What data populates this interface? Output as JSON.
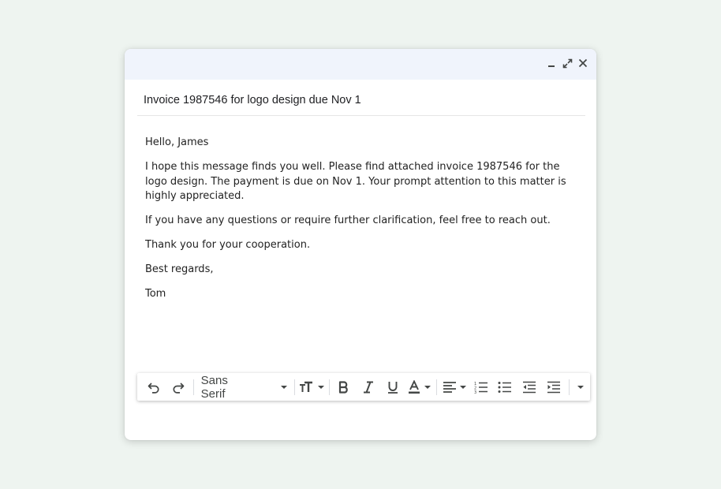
{
  "window": {
    "controls": [
      {
        "name": "minimize-icon"
      },
      {
        "name": "expand-icon"
      },
      {
        "name": "close-icon"
      }
    ]
  },
  "subject": "Invoice 1987546 for logo design due Nov 1",
  "body": {
    "greeting": "Hello, James",
    "paragraph1": "I hope this message finds you well. Please find attached invoice 1987546 for the logo design. The payment is due on Nov 1. Your prompt attention to this matter is highly appreciated.",
    "paragraph2": "If you have any questions or require further clarification, feel free to reach out.",
    "paragraph3": "Thank you for your cooperation.",
    "closing": "Best regards,",
    "signature": "Tom"
  },
  "toolbar": {
    "font_family": "Sans Serif",
    "icons": [
      "undo-icon",
      "redo-icon",
      "font-size-icon",
      "bold-icon",
      "italic-icon",
      "underline-icon",
      "text-color-icon",
      "align-icon",
      "numbered-list-icon",
      "bulleted-list-icon",
      "indent-less-icon",
      "indent-more-icon",
      "more-options-icon"
    ]
  }
}
